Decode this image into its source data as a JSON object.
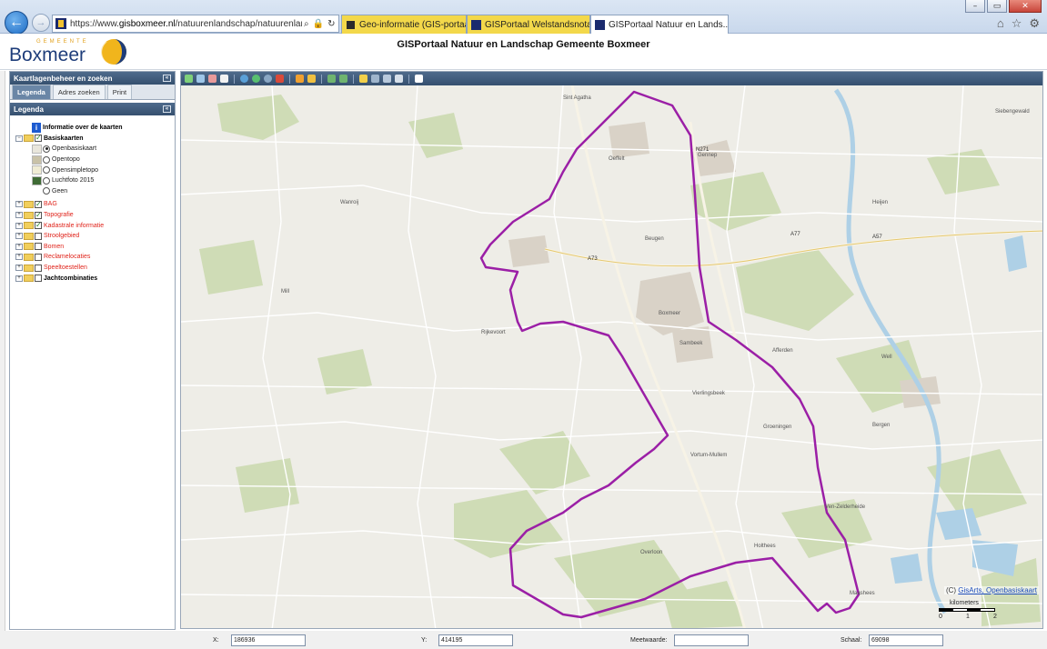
{
  "browser": {
    "window_controls": [
      "–",
      "▭",
      "✕"
    ],
    "address_url_domain": "gisboxmeer.nl",
    "address_url_prefix": "https://www.",
    "address_url_path": "/natuurenlandschap/natuurenlandschap.pl",
    "tabs": [
      {
        "label": "Geo-informatie (GIS-portaal) -...",
        "style": "yellow"
      },
      {
        "label": "GISPortaal Welstandsnota Ge...",
        "style": "yellow"
      },
      {
        "label": "GISPortaal Natuur en Lands...",
        "style": "active"
      }
    ],
    "tab_close_label": "✕",
    "toolbar_icons": [
      "home-icon",
      "star-icon",
      "gear-icon"
    ]
  },
  "header": {
    "logo_gemeente": "GEMEENTE",
    "logo_name": "Boxmeer",
    "title": "GISPortaal Natuur en Landschap Gemeente Boxmeer"
  },
  "panel": {
    "title": "Kaartlagenbeheer en zoeken",
    "tabs": [
      "Legenda",
      "Adres zoeken",
      "Print"
    ],
    "legend_title": "Legenda",
    "info_label": "Informatie over de kaarten",
    "basiskaarten_label": "Basiskaarten",
    "basemaps": [
      {
        "label": "Openbasiskaart",
        "selected": true
      },
      {
        "label": "Opentopo",
        "selected": false
      },
      {
        "label": "Opensimpletopo",
        "selected": false
      },
      {
        "label": "Luchtfoto 2015",
        "selected": false
      },
      {
        "label": "Geen",
        "selected": false
      }
    ],
    "layers": [
      {
        "label": "BAG",
        "checked": true,
        "red": true
      },
      {
        "label": "Topografie",
        "checked": true,
        "red": true
      },
      {
        "label": "Kadastrale informatie",
        "checked": true,
        "red": true
      },
      {
        "label": "Stroolgebied",
        "checked": false,
        "red": true
      },
      {
        "label": "Bomen",
        "checked": false,
        "red": true
      },
      {
        "label": "Reclamelocaties",
        "checked": false,
        "red": true
      },
      {
        "label": "Speeltoestellen",
        "checked": false,
        "red": true
      },
      {
        "label": "Jachtcombinaties",
        "checked": false,
        "red": false
      }
    ]
  },
  "map": {
    "credit_prefix": "(C)",
    "credit_link": "GisArts, Openbasiskaart",
    "scalebar_title": "kilometers",
    "scalebar_ticks": [
      "0",
      "1",
      "2"
    ],
    "boundary_color": "#9b1fa6",
    "place_labels": [
      "Sint Agatha",
      "Oeffelt",
      "Gennep",
      "Beugen",
      "Boxmeer",
      "Sambeek",
      "Vierlingsbeek",
      "Overloon",
      "Holthees",
      "Ven-Zelderheide",
      "Groeningen",
      "Afferden",
      "Heijen",
      "Siebengewald",
      "Well",
      "Bergen",
      "Wanroij",
      "Mill",
      "Rijkevoort",
      "Vortum-Mullem",
      "Maashees"
    ],
    "road_labels": [
      "A73",
      "A77",
      "N271",
      "A57"
    ]
  },
  "status": {
    "x_label": "X:",
    "x_value": "186936",
    "y_label": "Y:",
    "y_value": "414195",
    "meet_label": "Meetwaarde:",
    "meet_value": "",
    "schaal_label": "Schaal:",
    "schaal_value": "69098"
  }
}
